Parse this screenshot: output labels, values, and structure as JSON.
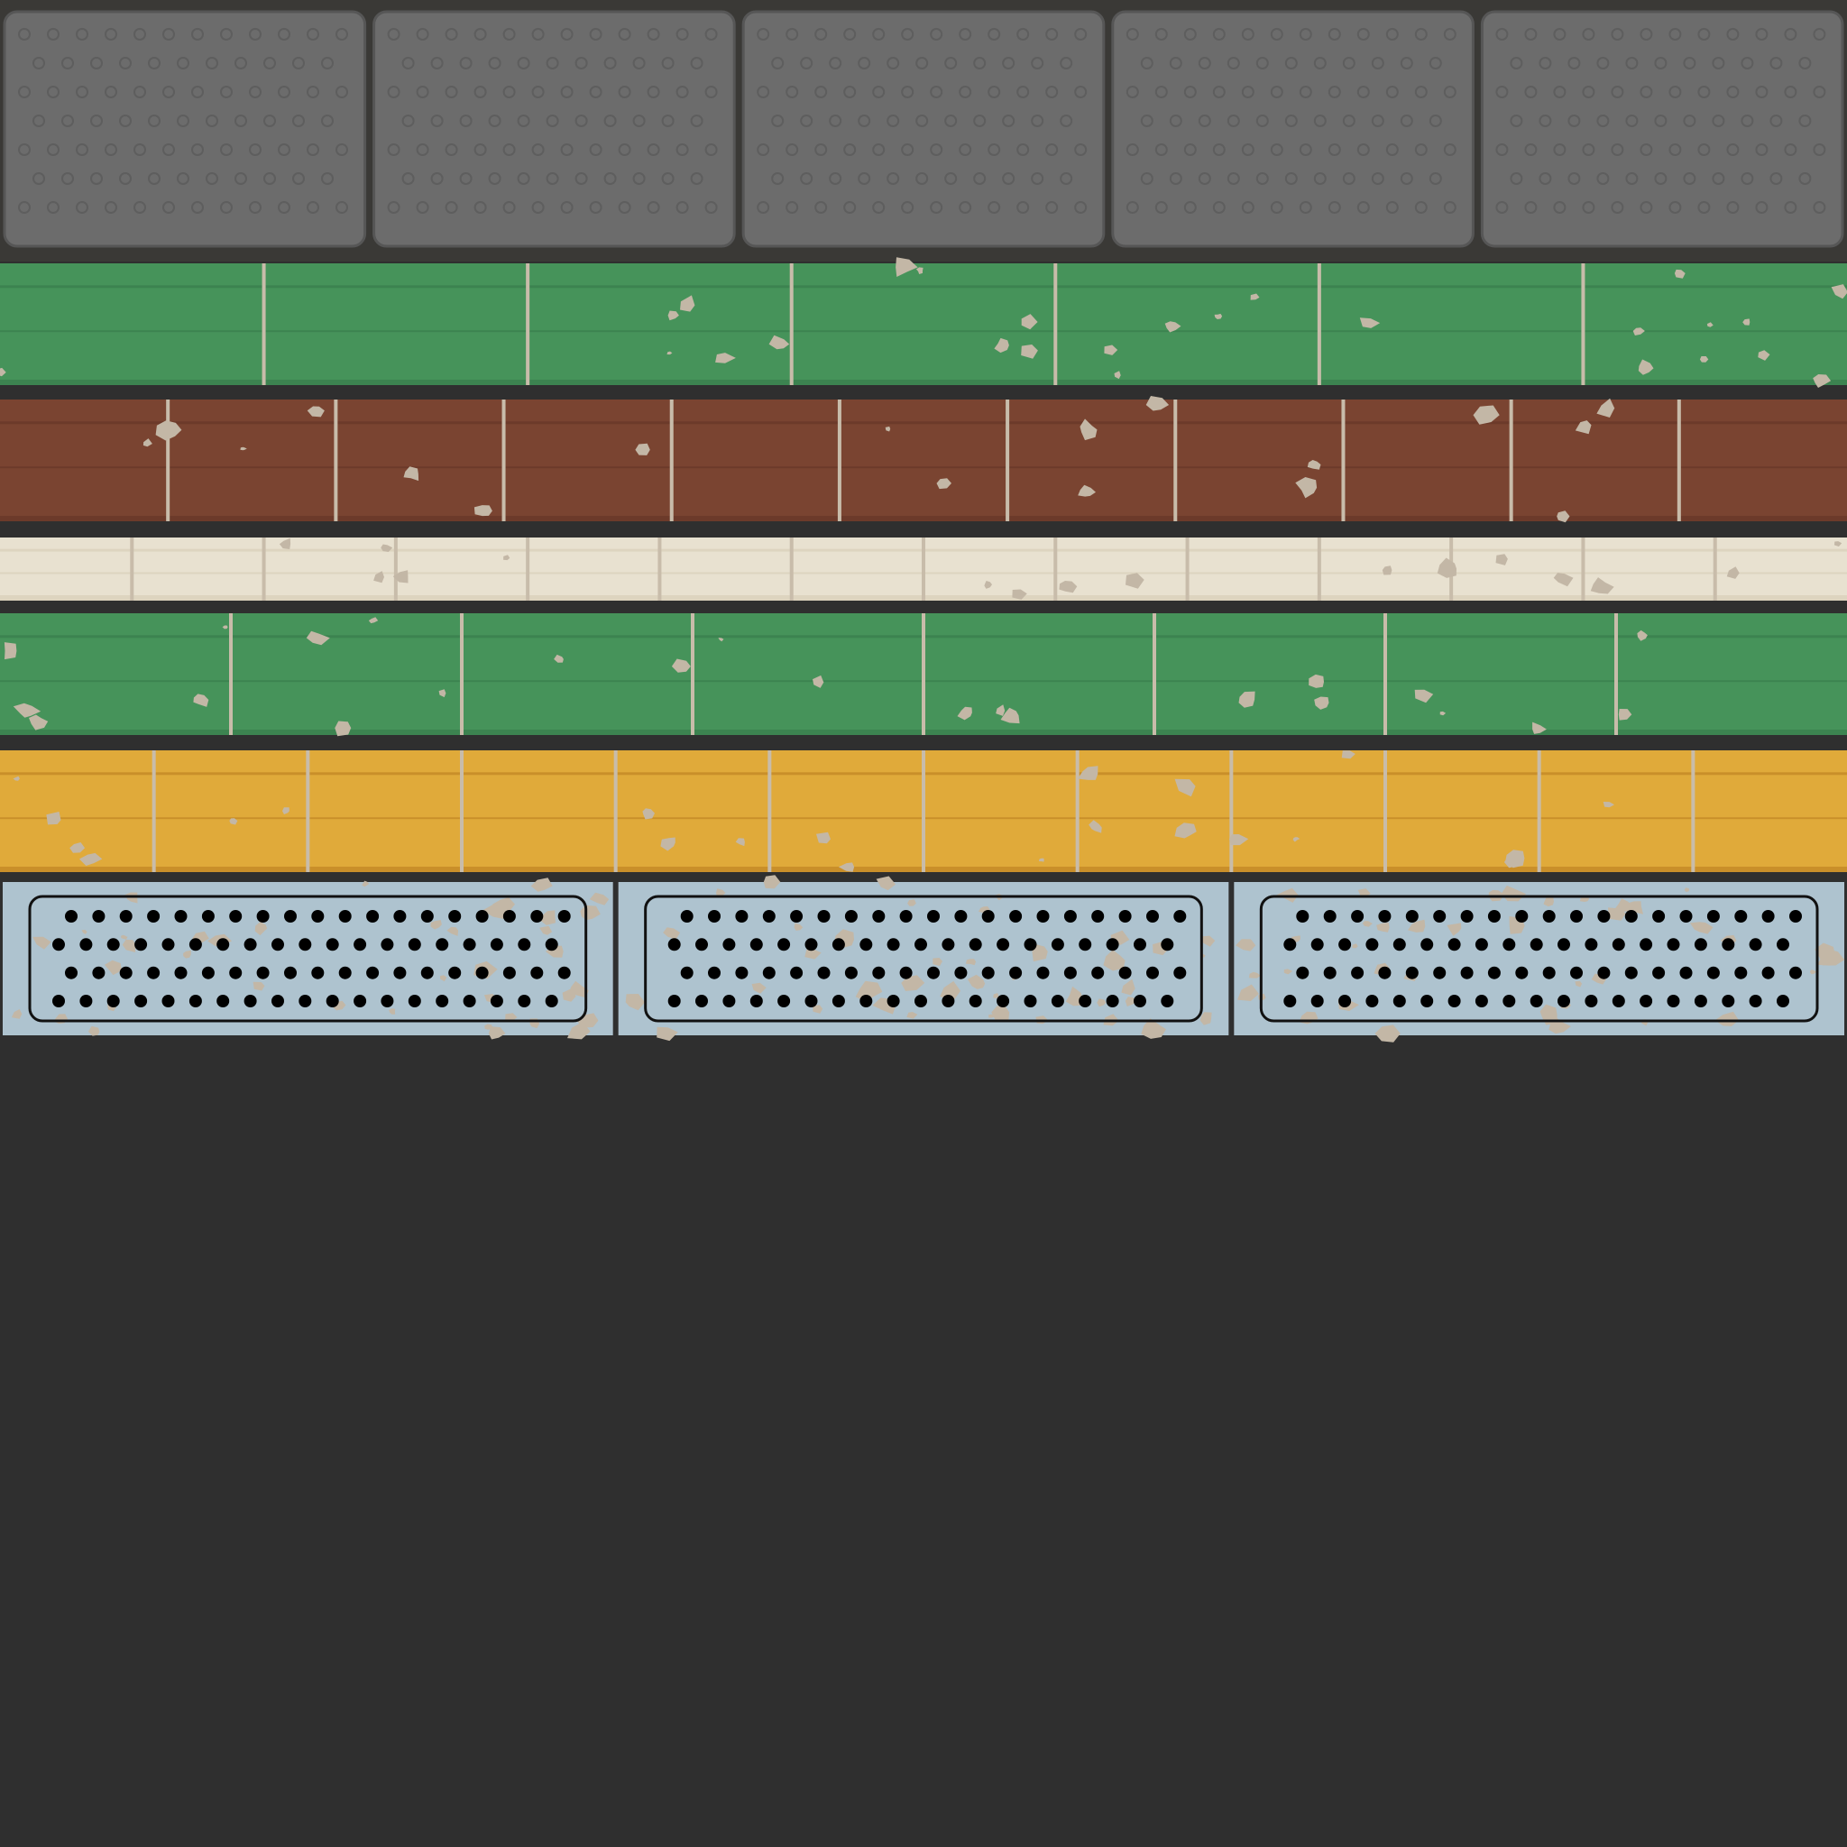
{
  "colors": {
    "background": "#2f2f2f",
    "concrete_tile": "#6c6c6c",
    "concrete_tile_edge": "#565656",
    "concrete_dimple": "#5e5e5e",
    "grout": "#c8bcaa",
    "chip": "#c3b7a6",
    "green_tile": "#46935a",
    "green_tile_dark": "#3c8350",
    "brick_red_tile": "#7a4431",
    "brick_red_tile_dark": "#6c3a2a",
    "cream_tile": "#e8e1d0",
    "cream_tile_dark": "#ddd4bf",
    "yellow_tile": "#e0aa3a",
    "yellow_tile_dark": "#c98f2a",
    "metal_plate": "#aec3cf",
    "rust": "#b08a73",
    "hole": "#000000"
  },
  "texture": {
    "concrete_tiles": 5,
    "green_top_tiles": 7,
    "red_tiles": 11,
    "cream_tiles": 14,
    "green_bottom_tiles": 8,
    "yellow_tiles": 12,
    "vent_plates": 3,
    "vent_hole_rows": 4,
    "vent_holes_per_row": 19
  }
}
